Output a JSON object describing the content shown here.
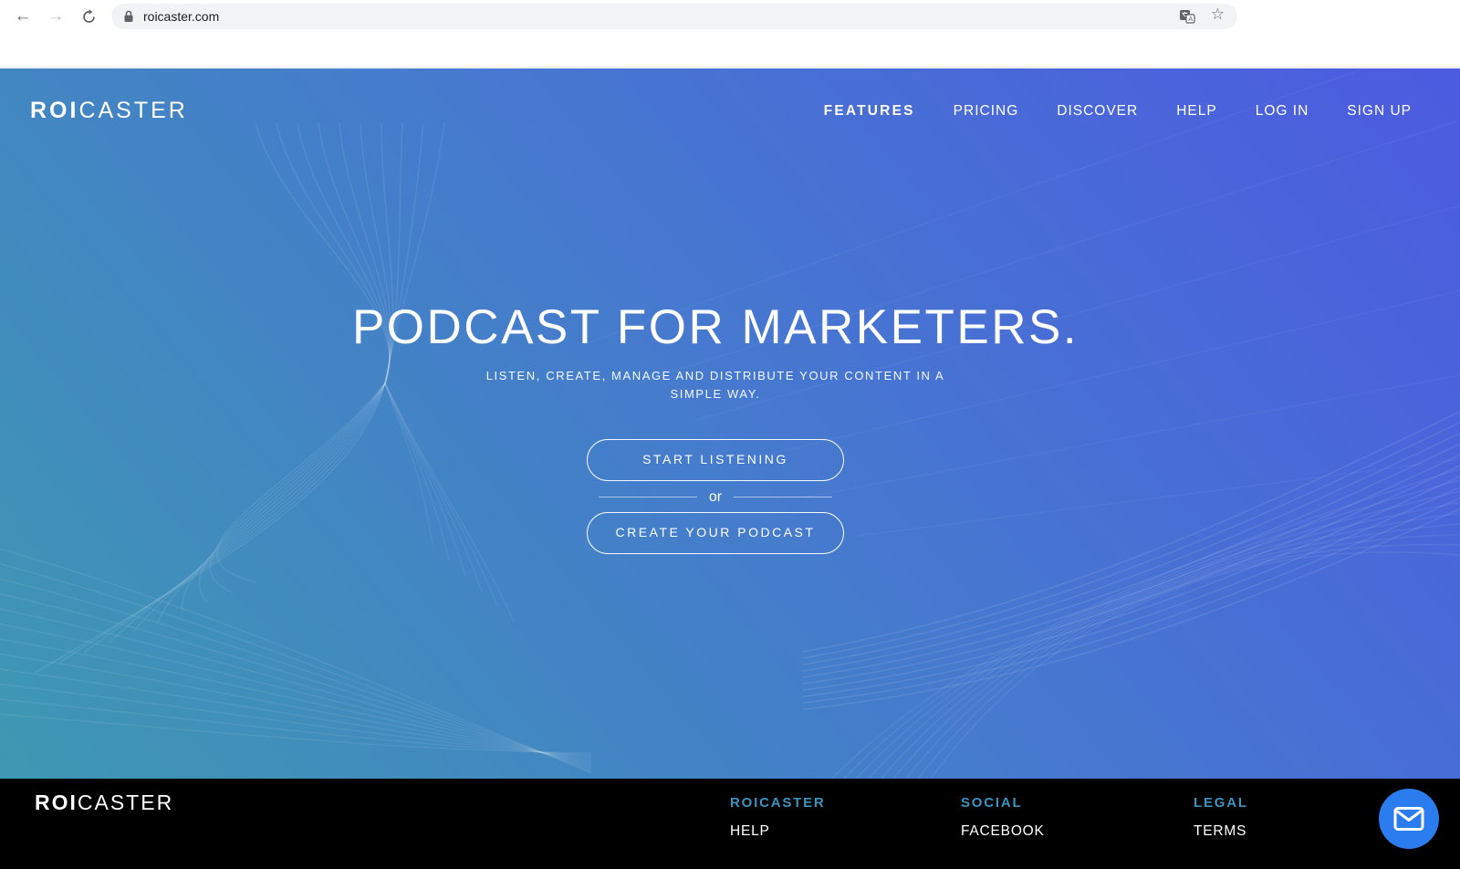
{
  "browser": {
    "url": "roicaster.com",
    "back_glyph": "←",
    "forward_glyph": "→",
    "star_glyph": "☆"
  },
  "header": {
    "logo_bold": "ROI",
    "logo_light": "CASTER",
    "nav": [
      {
        "label": "FEATURES",
        "active": true
      },
      {
        "label": "PRICING",
        "active": false
      },
      {
        "label": "DISCOVER",
        "active": false
      },
      {
        "label": "HELP",
        "active": false
      },
      {
        "label": "LOG IN",
        "active": false
      },
      {
        "label": "SIGN UP",
        "active": false
      }
    ]
  },
  "hero": {
    "title": "PODCAST FOR MARKETERS.",
    "subtitle": "LISTEN, CREATE, MANAGE AND DISTRIBUTE YOUR CONTENT IN A SIMPLE WAY.",
    "primary_button": "START LISTENING",
    "divider_text": "or",
    "secondary_button": "CREATE YOUR PODCAST"
  },
  "footer": {
    "logo_bold": "ROI",
    "logo_light": "CASTER",
    "columns": [
      {
        "heading": "ROICASTER",
        "links": [
          "HELP"
        ]
      },
      {
        "heading": "SOCIAL",
        "links": [
          "FACEBOOK"
        ]
      },
      {
        "heading": "LEGAL",
        "links": [
          "TERMS"
        ]
      }
    ]
  },
  "chat": {
    "icon": "mail-icon"
  },
  "colors": {
    "gradient_start": "#3E98B2",
    "gradient_mid": "#4679CF",
    "gradient_end": "#4C5BE0",
    "footer_heading": "#3E92C0",
    "footer_bg": "#000000",
    "chat_button": "#2B7CEE"
  }
}
